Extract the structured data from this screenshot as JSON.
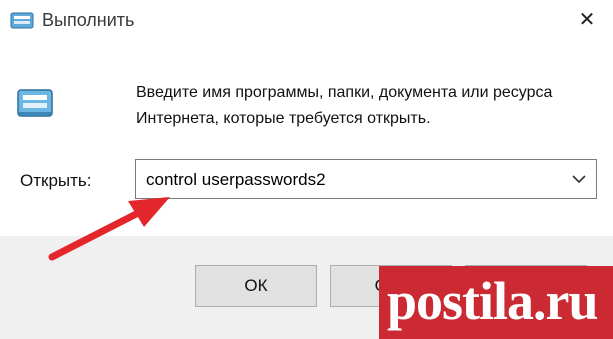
{
  "window": {
    "title": "Выполнить",
    "close_glyph": "✕",
    "title_icon": "run-icon"
  },
  "dialog": {
    "description": "Введите имя программы, папки, документа или ресурса Интернета, которые требуется открыть.",
    "open_label": "Открыть:",
    "open_value": "control userpasswords2",
    "run_icon": "run-dialog-icon"
  },
  "buttons": {
    "ok": "ОК",
    "cancel": "Отм",
    "browse": ""
  },
  "annotation": {
    "arrow_color": "#e3262b"
  },
  "watermark": {
    "text": "postila.ru",
    "color": "#cc2a33"
  }
}
